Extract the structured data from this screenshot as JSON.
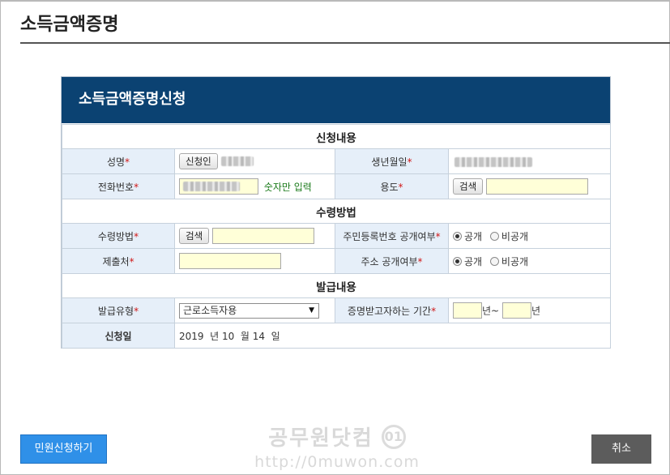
{
  "page": {
    "title": "소득금액증명"
  },
  "panel": {
    "title": "소득금액증명신청"
  },
  "sections": {
    "apply": "신청내용",
    "receive": "수령방법",
    "issue": "발급내용"
  },
  "fields": {
    "name_label": "성명",
    "name_button": "신청인",
    "birth_label": "생년월일",
    "phone_label": "전화번호",
    "phone_hint": "숫자만 입력",
    "purpose_label": "용도",
    "purpose_button": "검색",
    "receive_method_label": "수령방법",
    "receive_method_button": "검색",
    "rrn_disclose_label": "주민등록번호 공개여부",
    "submit_to_label": "제출처",
    "address_disclose_label": "주소 공개여부",
    "issue_type_label": "발급유형",
    "issue_type_value": "근로소득자용",
    "period_label": "증명받고자하는 기간",
    "period_year_unit_1": "년~",
    "period_year_unit_2": "년",
    "apply_date_label": "신청일",
    "apply_date_value": "2019  년 10  월 14  일"
  },
  "options": {
    "public": "공개",
    "private": "비공개",
    "rrn_selected": "공개",
    "address_selected": "공개"
  },
  "required_mark": "*",
  "footer": {
    "apply_button": "민원신청하기",
    "cancel_button": "취소"
  },
  "watermark": {
    "text": "공무원닷컴",
    "logo": "01",
    "url": "http://0muwon.com"
  }
}
